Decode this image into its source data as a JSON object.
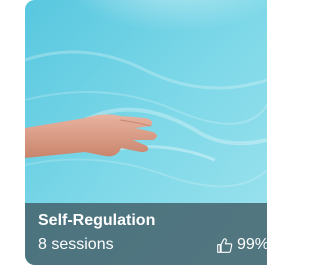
{
  "card": {
    "title": "Self-Regulation",
    "sessions": "8 sessions",
    "rating": "99%",
    "rating_icon": "thumbs-up-icon",
    "image_subject": "hand-over-water-image",
    "colors": {
      "water": "#6fd3e6",
      "info_bar": "#425e68",
      "text": "#ffffff"
    }
  }
}
